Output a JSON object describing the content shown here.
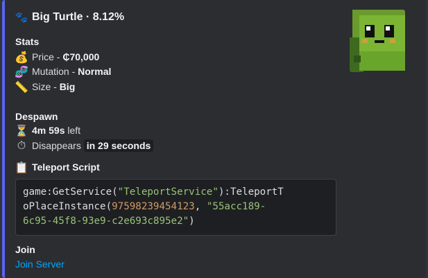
{
  "title": "Big Turtle · 8.12%",
  "stats": {
    "heading": "Stats",
    "price_label": "Price - ",
    "price_value": "₵70,000",
    "mutation_label": "Mutation - ",
    "mutation_value": "Normal",
    "size_label": "Size - ",
    "size_value": "Big"
  },
  "despawn": {
    "heading": "Despawn",
    "time_value": "4m 59s",
    "time_suffix": " left",
    "disappears_label": "Disappears ",
    "disappears_value": "in 29 seconds"
  },
  "teleport": {
    "heading": "Teleport Script",
    "code_prefix": "game:GetService(",
    "code_service": "\"TeleportService\"",
    "code_mid1": "):TeleportT",
    "code_mid2": "oPlaceInstance(",
    "code_place_id": "97598239454123",
    "code_sep": ", ",
    "code_job_id_1": "\"55acc189-",
    "code_job_id_2": "6c95-45f8-93e9-c2e693c895e2\"",
    "code_end": ")"
  },
  "join": {
    "heading": "Join",
    "link_label": "Join Server"
  },
  "icons": {
    "title": "paw-prints-icon",
    "price": "money-bag-icon",
    "mutation": "dna-icon",
    "size": "ruler-icon",
    "time": "hourglass-icon",
    "disappears": "stopwatch-icon",
    "teleport": "clipboard-icon"
  },
  "colors": {
    "accent": "#5865f2",
    "link": "#00a8fc",
    "code_string": "#98c379",
    "code_number": "#d19a66"
  }
}
